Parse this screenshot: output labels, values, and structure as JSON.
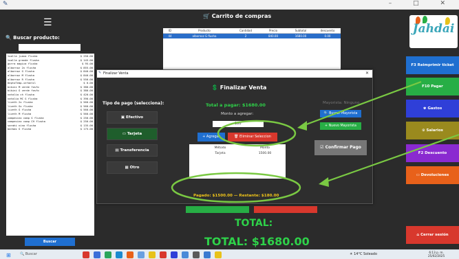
{
  "app": {
    "title_controls": [
      "–",
      "□",
      "✕"
    ]
  },
  "left": {
    "menu_icon": "hamburger-icon",
    "search_label": "Buscar producto:",
    "search_value": "",
    "products": [
      {
        "name": "toalla juana flusha",
        "price": "$ 250.00"
      },
      {
        "name": "toalla grande flusha",
        "price": "$ 145.00"
      },
      {
        "name": "gorra magica flusha",
        "price": "$  95.00"
      },
      {
        "name": "albornoz 2x flusha",
        "price": "$ 855.00"
      },
      {
        "name": "albornoz G flusha",
        "price": "$ 840.00"
      },
      {
        "name": "albornoz M flusha",
        "price": "$ 840.00"
      },
      {
        "name": "albornoz R flusha",
        "price": "$ 550.00"
      },
      {
        "name": "DeptoTemp-infantil",
        "price": "$   0.00"
      },
      {
        "name": "bikini M verde fosfo",
        "price": "$ 380.00"
      },
      {
        "name": "bikini G verde fosfo",
        "price": "$ 380.00"
      },
      {
        "name": "natalia ch flusha",
        "price": "$ 420.00"
      },
      {
        "name": "natalia MC G flusha",
        "price": "$ 390.00"
      },
      {
        "name": "lizeth 2x flusha",
        "price": "$ 560.00"
      },
      {
        "name": "lizeth Gx flusha",
        "price": "$ 560.00"
      },
      {
        "name": "lizeth G flusha",
        "price": "$ 560.00"
      },
      {
        "name": "lizeth M flusha",
        "price": "$ 560.00"
      },
      {
        "name": "campesino comp G flusha",
        "price": "$ 250.00"
      },
      {
        "name": "campesino comp CH flusha",
        "price": "$ 250.00"
      },
      {
        "name": "sarahi nino flusha",
        "price": "$ 135.00"
      },
      {
        "name": "barbas G flusha",
        "price": "$ 175.00"
      }
    ],
    "search_button": "Buscar"
  },
  "cart": {
    "title": "Carrito de compras",
    "columns": [
      "ID",
      "Producto",
      "Cantidad",
      "Precio",
      "Subtotal",
      "descuento"
    ],
    "rows": [
      [
        "44",
        "albornoz G flusha",
        "2",
        "840.00",
        "1680.00",
        "0.00"
      ]
    ],
    "total_label": "TOTAL:",
    "total_value": "TOTAL: $1680.00"
  },
  "right": {
    "logo_text": "Jahdai",
    "buttons": [
      {
        "label": "F3 Reimprimir ticket",
        "color": "#1f6fd0"
      },
      {
        "label": "F10 Pagar",
        "color": "#27ae45"
      },
      {
        "label": "♚ Gastos",
        "color": "#2f3fd8"
      },
      {
        "label": "⊙ Salarios",
        "color": "#9a8a1e"
      },
      {
        "label": "F2 Descuento",
        "color": "#8a2ad0"
      },
      {
        "label": "▭ Devoluciones",
        "color": "#e8611a"
      },
      {
        "label": "⌂ Cerrar sesión",
        "color": "#d8382d"
      }
    ]
  },
  "dialog": {
    "window_title": "Finalizar Venta",
    "title": "Finalizar Venta",
    "pay_type_label": "Tipo de pago (selecciona):",
    "pay_buttons": [
      {
        "label": "Efectivo",
        "icon": "cash-icon"
      },
      {
        "label": "Tarjeta",
        "icon": "card-icon"
      },
      {
        "label": "Transferencia",
        "icon": "transfer-icon"
      },
      {
        "label": "Otro",
        "icon": "other-icon"
      }
    ],
    "total_to_pay": "Total a pagar: $1680.00",
    "amount_label": "Monto a agregar:",
    "amount_value": "180",
    "add_button": "+ Agregar",
    "remove_button": "Eliminar Seleccion",
    "methods_columns": [
      "Método",
      "Monto"
    ],
    "methods_rows": [
      [
        "Tarjeta",
        "1500.00"
      ]
    ],
    "mayorista_label": "Mayorista: Ninguno",
    "search_mayorista": "Buscar Mayorista",
    "new_mayorista": "+ Nuevo Mayorista",
    "confirm_button": "Confirmar Pago",
    "paid_summary": "Pagado: $1500.00  —  Restante: $180.00"
  },
  "taskbar": {
    "search_placeholder": "Buscar",
    "weather": "14°C  Soleado",
    "time": "6:13 p. m.",
    "date": "25/02/2025"
  }
}
